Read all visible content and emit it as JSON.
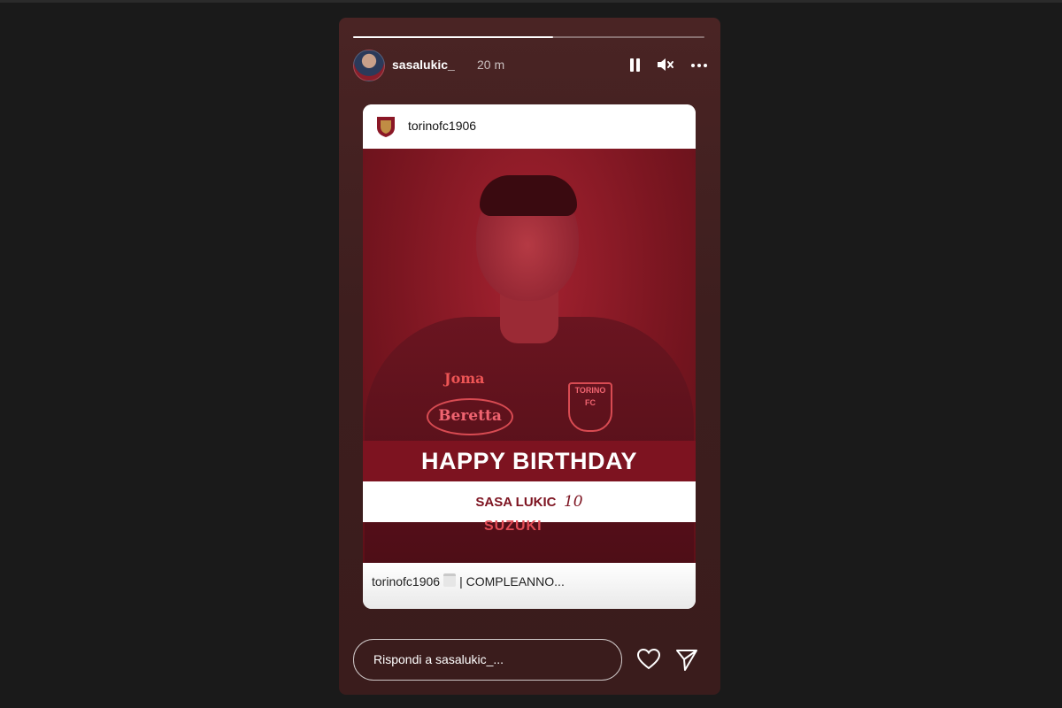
{
  "story": {
    "progress": 0.57,
    "username": "sasalukic_",
    "time": "20 m",
    "icons": {
      "pause": "pause-icon",
      "mute": "mute-icon",
      "more": "more-icon",
      "heart": "heart-icon",
      "send": "send-icon"
    }
  },
  "shared_post": {
    "username": "torinofc1906",
    "headline": "HAPPY BIRTHDAY",
    "player_name": "SASA LUKIC",
    "player_number": "10",
    "sponsor_top": "Joma",
    "sponsor_chest": "Beretta",
    "crest_text": "TORINO FC",
    "sponsor_bottom": "SUZUKI",
    "caption_user": "torinofc1906",
    "caption_text": "| COMPLEANNO..."
  },
  "reply": {
    "placeholder": "Rispondi a sasalukic_..."
  },
  "colors": {
    "torino_maroon": "#7d1320",
    "story_bg": "#3d1e1e"
  }
}
